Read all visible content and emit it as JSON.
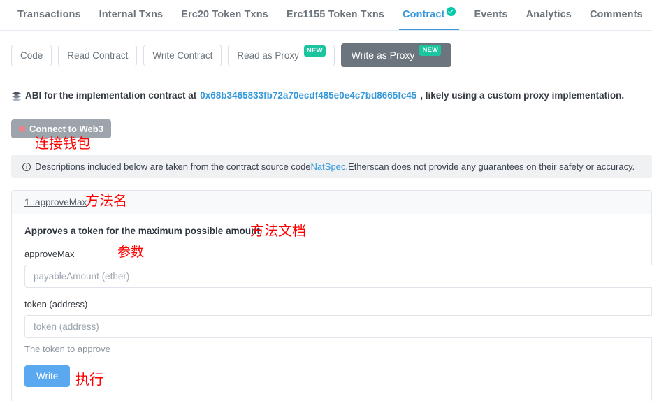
{
  "tabs": [
    {
      "label": "Transactions",
      "active": false
    },
    {
      "label": "Internal Txns",
      "active": false
    },
    {
      "label": "Erc20 Token Txns",
      "active": false
    },
    {
      "label": "Erc1155 Token Txns",
      "active": false
    },
    {
      "label": "Contract",
      "active": true,
      "verified": true
    },
    {
      "label": "Events",
      "active": false
    },
    {
      "label": "Analytics",
      "active": false
    },
    {
      "label": "Comments",
      "active": false
    }
  ],
  "contract_buttons": [
    {
      "label": "Code",
      "active": false,
      "badge": ""
    },
    {
      "label": "Read Contract",
      "active": false,
      "badge": ""
    },
    {
      "label": "Write Contract",
      "active": false,
      "badge": ""
    },
    {
      "label": "Read as Proxy",
      "active": false,
      "badge": "NEW"
    },
    {
      "label": "Write as Proxy",
      "active": true,
      "badge": "NEW"
    }
  ],
  "abi_notice": {
    "icon": "stack-icon",
    "prefix": "ABI for the implementation contract at ",
    "address": "0x68b3465833fb72a70ecdf485e0e4c7bd8665fc45",
    "suffix": ", likely using a custom proxy implementation."
  },
  "web3": {
    "button_label": "Connect to Web3",
    "status_color": "#f2808c"
  },
  "notice": {
    "prefix": "Descriptions included below are taken from the contract source code ",
    "link": "NatSpec.",
    "suffix": " Etherscan does not provide any guarantees on their safety or accuracy."
  },
  "function": {
    "name": "1. approveMax",
    "description": "Approves a token for the maximum possible amount",
    "fields": [
      {
        "label": "approveMax",
        "placeholder": "payableAmount (ether)",
        "value": "",
        "help": ""
      },
      {
        "label": "token (address)",
        "placeholder": "token (address)",
        "value": "",
        "help": "The token to approve"
      }
    ],
    "submit_label": "Write"
  },
  "annotations": {
    "wallet": "连接钱包",
    "method_name": "方法名",
    "method_doc": "方法文档",
    "parameter": "参数",
    "execute": "执行",
    "color": "#ff0000"
  }
}
